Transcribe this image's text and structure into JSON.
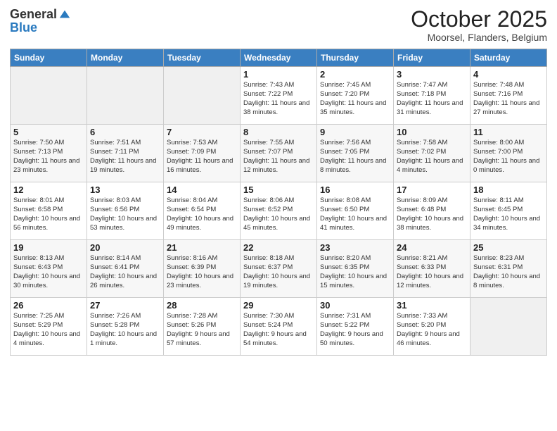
{
  "header": {
    "logo_line1": "General",
    "logo_line2": "Blue",
    "month": "October 2025",
    "location": "Moorsel, Flanders, Belgium"
  },
  "weekdays": [
    "Sunday",
    "Monday",
    "Tuesday",
    "Wednesday",
    "Thursday",
    "Friday",
    "Saturday"
  ],
  "weeks": [
    [
      {
        "day": "",
        "info": ""
      },
      {
        "day": "",
        "info": ""
      },
      {
        "day": "",
        "info": ""
      },
      {
        "day": "1",
        "info": "Sunrise: 7:43 AM\nSunset: 7:22 PM\nDaylight: 11 hours and 38 minutes."
      },
      {
        "day": "2",
        "info": "Sunrise: 7:45 AM\nSunset: 7:20 PM\nDaylight: 11 hours and 35 minutes."
      },
      {
        "day": "3",
        "info": "Sunrise: 7:47 AM\nSunset: 7:18 PM\nDaylight: 11 hours and 31 minutes."
      },
      {
        "day": "4",
        "info": "Sunrise: 7:48 AM\nSunset: 7:16 PM\nDaylight: 11 hours and 27 minutes."
      }
    ],
    [
      {
        "day": "5",
        "info": "Sunrise: 7:50 AM\nSunset: 7:13 PM\nDaylight: 11 hours and 23 minutes."
      },
      {
        "day": "6",
        "info": "Sunrise: 7:51 AM\nSunset: 7:11 PM\nDaylight: 11 hours and 19 minutes."
      },
      {
        "day": "7",
        "info": "Sunrise: 7:53 AM\nSunset: 7:09 PM\nDaylight: 11 hours and 16 minutes."
      },
      {
        "day": "8",
        "info": "Sunrise: 7:55 AM\nSunset: 7:07 PM\nDaylight: 11 hours and 12 minutes."
      },
      {
        "day": "9",
        "info": "Sunrise: 7:56 AM\nSunset: 7:05 PM\nDaylight: 11 hours and 8 minutes."
      },
      {
        "day": "10",
        "info": "Sunrise: 7:58 AM\nSunset: 7:02 PM\nDaylight: 11 hours and 4 minutes."
      },
      {
        "day": "11",
        "info": "Sunrise: 8:00 AM\nSunset: 7:00 PM\nDaylight: 11 hours and 0 minutes."
      }
    ],
    [
      {
        "day": "12",
        "info": "Sunrise: 8:01 AM\nSunset: 6:58 PM\nDaylight: 10 hours and 56 minutes."
      },
      {
        "day": "13",
        "info": "Sunrise: 8:03 AM\nSunset: 6:56 PM\nDaylight: 10 hours and 53 minutes."
      },
      {
        "day": "14",
        "info": "Sunrise: 8:04 AM\nSunset: 6:54 PM\nDaylight: 10 hours and 49 minutes."
      },
      {
        "day": "15",
        "info": "Sunrise: 8:06 AM\nSunset: 6:52 PM\nDaylight: 10 hours and 45 minutes."
      },
      {
        "day": "16",
        "info": "Sunrise: 8:08 AM\nSunset: 6:50 PM\nDaylight: 10 hours and 41 minutes."
      },
      {
        "day": "17",
        "info": "Sunrise: 8:09 AM\nSunset: 6:48 PM\nDaylight: 10 hours and 38 minutes."
      },
      {
        "day": "18",
        "info": "Sunrise: 8:11 AM\nSunset: 6:45 PM\nDaylight: 10 hours and 34 minutes."
      }
    ],
    [
      {
        "day": "19",
        "info": "Sunrise: 8:13 AM\nSunset: 6:43 PM\nDaylight: 10 hours and 30 minutes."
      },
      {
        "day": "20",
        "info": "Sunrise: 8:14 AM\nSunset: 6:41 PM\nDaylight: 10 hours and 26 minutes."
      },
      {
        "day": "21",
        "info": "Sunrise: 8:16 AM\nSunset: 6:39 PM\nDaylight: 10 hours and 23 minutes."
      },
      {
        "day": "22",
        "info": "Sunrise: 8:18 AM\nSunset: 6:37 PM\nDaylight: 10 hours and 19 minutes."
      },
      {
        "day": "23",
        "info": "Sunrise: 8:20 AM\nSunset: 6:35 PM\nDaylight: 10 hours and 15 minutes."
      },
      {
        "day": "24",
        "info": "Sunrise: 8:21 AM\nSunset: 6:33 PM\nDaylight: 10 hours and 12 minutes."
      },
      {
        "day": "25",
        "info": "Sunrise: 8:23 AM\nSunset: 6:31 PM\nDaylight: 10 hours and 8 minutes."
      }
    ],
    [
      {
        "day": "26",
        "info": "Sunrise: 7:25 AM\nSunset: 5:29 PM\nDaylight: 10 hours and 4 minutes."
      },
      {
        "day": "27",
        "info": "Sunrise: 7:26 AM\nSunset: 5:28 PM\nDaylight: 10 hours and 1 minute."
      },
      {
        "day": "28",
        "info": "Sunrise: 7:28 AM\nSunset: 5:26 PM\nDaylight: 9 hours and 57 minutes."
      },
      {
        "day": "29",
        "info": "Sunrise: 7:30 AM\nSunset: 5:24 PM\nDaylight: 9 hours and 54 minutes."
      },
      {
        "day": "30",
        "info": "Sunrise: 7:31 AM\nSunset: 5:22 PM\nDaylight: 9 hours and 50 minutes."
      },
      {
        "day": "31",
        "info": "Sunrise: 7:33 AM\nSunset: 5:20 PM\nDaylight: 9 hours and 46 minutes."
      },
      {
        "day": "",
        "info": ""
      }
    ]
  ]
}
